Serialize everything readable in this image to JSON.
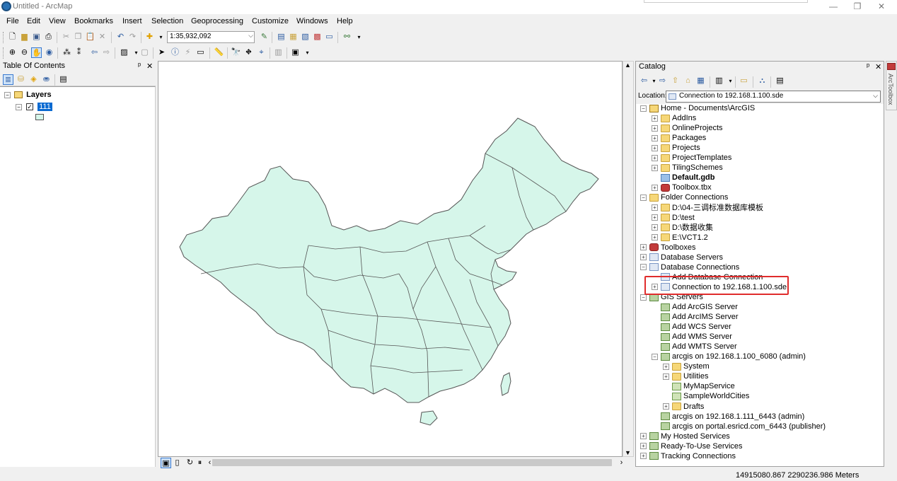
{
  "window": {
    "title": "Untitled - ArcMap",
    "controls": {
      "minimize": "—",
      "maximize": "❐",
      "close": "✕"
    }
  },
  "menu": [
    "File",
    "Edit",
    "View",
    "Bookmarks",
    "Insert",
    "Selection",
    "Geoprocessing",
    "Customize",
    "Windows",
    "Help"
  ],
  "toolbar": {
    "scale": "1:35,932,092"
  },
  "toc": {
    "title": "Table Of Contents",
    "pin": "ᵖ",
    "close": "✕",
    "layers_label": "Layers",
    "layer_name": "111"
  },
  "map": {
    "fill_color": "#d6f6ea",
    "stroke_color": "#555555"
  },
  "catalog": {
    "title": "Catalog",
    "location_label": "Location:",
    "location_value": "Connection to 192.168.1.100.sde",
    "side_tab": "ArcToolbox",
    "tree": [
      {
        "label": "Home - Documents\\ArcGIS",
        "icon": "home-folder-icon",
        "exp": "−"
      },
      {
        "label": "AddIns",
        "icon": "folder-icon",
        "exp": "+"
      },
      {
        "label": "OnlineProjects",
        "icon": "folder-icon",
        "exp": "+"
      },
      {
        "label": "Packages",
        "icon": "folder-icon",
        "exp": "+"
      },
      {
        "label": "Projects",
        "icon": "folder-icon",
        "exp": "+"
      },
      {
        "label": "ProjectTemplates",
        "icon": "folder-icon",
        "exp": "+"
      },
      {
        "label": "TilingSchemes",
        "icon": "folder-icon",
        "exp": "+"
      },
      {
        "label": "Default.gdb",
        "icon": "geodatabase-icon",
        "exp": ""
      },
      {
        "label": "Toolbox.tbx",
        "icon": "toolbox-icon",
        "exp": "+"
      },
      {
        "label": "Folder Connections",
        "icon": "folder-connection-icon",
        "exp": "−"
      },
      {
        "label": "D:\\04-三调标准数据库模板",
        "icon": "folder-icon",
        "exp": "+"
      },
      {
        "label": "D:\\test",
        "icon": "folder-icon",
        "exp": "+"
      },
      {
        "label": "D:\\数据收集",
        "icon": "folder-icon",
        "exp": "+"
      },
      {
        "label": "E:\\VCT1.2",
        "icon": "folder-icon",
        "exp": "+"
      },
      {
        "label": "Toolboxes",
        "icon": "toolboxes-icon",
        "exp": "+"
      },
      {
        "label": "Database Servers",
        "icon": "database-server-icon",
        "exp": "+"
      },
      {
        "label": "Database Connections",
        "icon": "database-connections-icon",
        "exp": "−"
      },
      {
        "label": "Add Database Connection",
        "icon": "add-db-connection-icon",
        "exp": ""
      },
      {
        "label": "Connection to 192.168.1.100.sde",
        "icon": "sde-connection-icon",
        "exp": "+"
      },
      {
        "label": "GIS Servers",
        "icon": "gis-servers-icon",
        "exp": "−"
      },
      {
        "label": "Add ArcGIS Server",
        "icon": "add-server-icon",
        "exp": ""
      },
      {
        "label": "Add ArcIMS Server",
        "icon": "add-server-icon",
        "exp": ""
      },
      {
        "label": "Add WCS Server",
        "icon": "add-server-icon",
        "exp": ""
      },
      {
        "label": "Add WMS Server",
        "icon": "add-server-icon",
        "exp": ""
      },
      {
        "label": "Add WMTS Server",
        "icon": "add-server-icon",
        "exp": ""
      },
      {
        "label": "arcgis on 192.168.1.100_6080 (admin)",
        "icon": "arcgis-server-icon",
        "exp": "−"
      },
      {
        "label": "System",
        "icon": "folder-icon",
        "exp": "+"
      },
      {
        "label": "Utilities",
        "icon": "folder-icon",
        "exp": "+"
      },
      {
        "label": "MyMapService",
        "icon": "map-service-icon",
        "exp": ""
      },
      {
        "label": "SampleWorldCities",
        "icon": "map-service-icon",
        "exp": ""
      },
      {
        "label": "Drafts",
        "icon": "drafts-icon",
        "exp": "+"
      },
      {
        "label": "arcgis on 192.168.1.111_6443 (admin)",
        "icon": "arcgis-server-disconnected-icon",
        "exp": ""
      },
      {
        "label": "arcgis on portal.esricd.com_6443 (publisher)",
        "icon": "arcgis-server-disconnected-icon",
        "exp": ""
      },
      {
        "label": "My Hosted Services",
        "icon": "hosted-services-icon",
        "exp": "+"
      },
      {
        "label": "Ready-To-Use Services",
        "icon": "ready-services-icon",
        "exp": "+"
      },
      {
        "label": "Tracking Connections",
        "icon": "tracking-icon",
        "exp": "+"
      }
    ]
  },
  "status": {
    "coordinates": "14915080.867  2290236.986 Meters"
  }
}
